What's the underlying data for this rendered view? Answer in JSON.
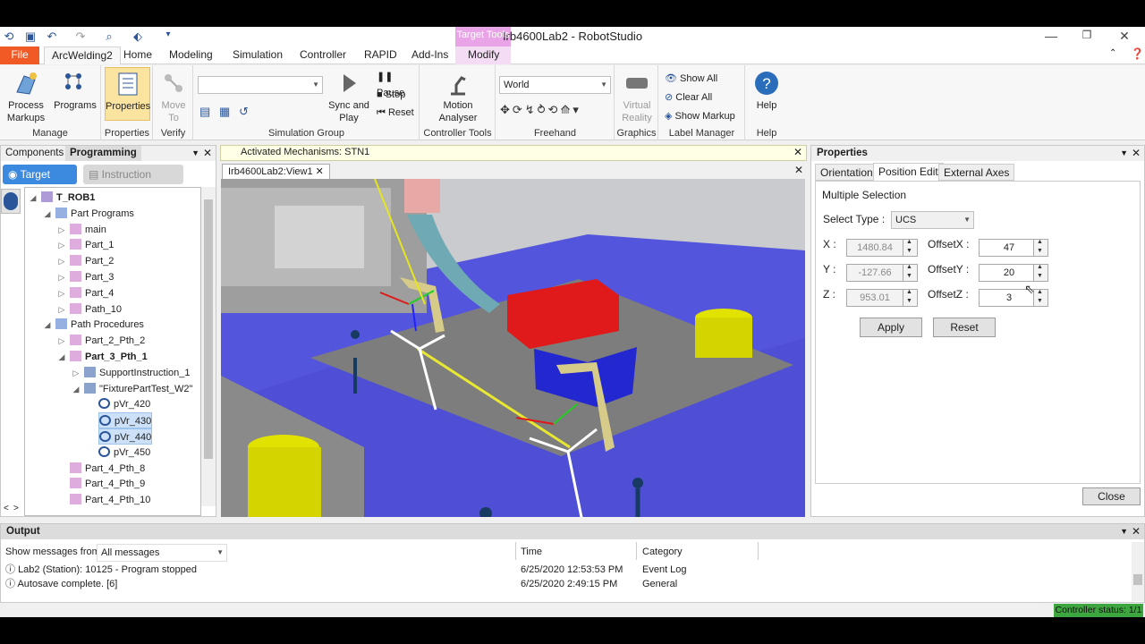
{
  "window": {
    "title": "Irb4600Lab2 - RobotStudio",
    "context_tab_group": "Target Tools"
  },
  "tabs": [
    "File",
    "ArcWelding2",
    "Home",
    "Modeling",
    "Simulation",
    "Controller",
    "RAPID",
    "Add-Ins",
    "Modify"
  ],
  "ribbon": {
    "manage": {
      "label": "Manage",
      "process_markups": "Process Markups",
      "programs": "Programs"
    },
    "properties": {
      "label": "Properties",
      "button": "Properties"
    },
    "verify": {
      "label": "Verify",
      "move_to": "Move To"
    },
    "simulation": {
      "label": "Simulation Group",
      "sync": "Sync and Play",
      "pause": "Pause",
      "stop": "Stop",
      "reset": "Reset"
    },
    "controller_tools": {
      "label": "Controller Tools",
      "motion": "Motion Analyser"
    },
    "freehand": {
      "label": "Freehand",
      "frame": "World"
    },
    "graphics": {
      "label": "Graphics",
      "vr": "Virtual Reality"
    },
    "label_manager": {
      "label": "Label Manager",
      "show_all": "Show All",
      "clear_all": "Clear All",
      "show_markup": "Show Markup"
    },
    "help": {
      "label": "Help",
      "button": "Help"
    }
  },
  "left_panel": {
    "tabs": [
      "Components",
      "Programming"
    ],
    "mode_target": "Target",
    "mode_instruction": "Instruction",
    "tree": [
      {
        "text": "T_ROB1",
        "bold": true,
        "level": 0,
        "exp": "◢"
      },
      {
        "text": "Part Programs",
        "level": 1,
        "exp": "◢"
      },
      {
        "text": "main",
        "level": 2,
        "exp": "▷"
      },
      {
        "text": "Part_1",
        "level": 2,
        "exp": "▷"
      },
      {
        "text": "Part_2",
        "level": 2,
        "exp": "▷"
      },
      {
        "text": "Part_3",
        "level": 2,
        "exp": "▷"
      },
      {
        "text": "Part_4",
        "level": 2,
        "exp": "▷"
      },
      {
        "text": "Path_10",
        "level": 2,
        "exp": "▷"
      },
      {
        "text": "Path Procedures",
        "level": 1,
        "exp": "◢"
      },
      {
        "text": "Part_2_Pth_2",
        "level": 2,
        "exp": "▷"
      },
      {
        "text": "Part_3_Pth_1",
        "bold": true,
        "level": 2,
        "exp": "◢"
      },
      {
        "text": "SupportInstruction_1",
        "level": 3,
        "exp": "▷"
      },
      {
        "text": "\"FixturePartTest_W2\"",
        "level": 3,
        "exp": "◢"
      },
      {
        "text": "pVr_420",
        "level": 4,
        "exp": ""
      },
      {
        "text": "pVr_430",
        "level": 4,
        "exp": "",
        "selected": true
      },
      {
        "text": "pVr_440",
        "level": 4,
        "exp": "",
        "selected": true
      },
      {
        "text": "pVr_450",
        "level": 4,
        "exp": ""
      },
      {
        "text": "Part_4_Pth_8",
        "level": 2,
        "exp": ""
      },
      {
        "text": "Part_4_Pth_9",
        "level": 2,
        "exp": ""
      },
      {
        "text": "Part_4_Pth_10",
        "level": 2,
        "exp": ""
      }
    ]
  },
  "center": {
    "activated": "Activated Mechanisms: STN1",
    "doc_tab": "Irb4600Lab2:View1"
  },
  "properties_panel": {
    "title": "Properties",
    "tabs": [
      "Orientation",
      "Position Edit",
      "External Axes"
    ],
    "section": "Multiple Selection",
    "select_type_label": "Select Type :",
    "select_type_value": "UCS",
    "x_label": "X :",
    "x_value": "1480.84",
    "y_label": "Y :",
    "y_value": "-127.66",
    "z_label": "Z :",
    "z_value": "953.01",
    "ox_label": "OffsetX :",
    "ox_value": "47",
    "oy_label": "OffsetY :",
    "oy_value": "20",
    "oz_label": "OffsetZ :",
    "oz_value": "3",
    "apply": "Apply",
    "reset": "Reset",
    "close": "Close"
  },
  "output": {
    "title": "Output",
    "filter_label": "Show messages from:",
    "filter_value": "All messages",
    "col_time": "Time",
    "col_category": "Category",
    "rows": [
      {
        "msg": "Lab2 (Station): 10125 - Program stopped",
        "time": "6/25/2020 12:53:53 PM",
        "cat": "Event Log"
      },
      {
        "msg": "Autosave complete. [6]",
        "time": "6/25/2020 2:49:15 PM",
        "cat": "General"
      }
    ]
  },
  "status": {
    "controller": "Controller status: 1/1"
  }
}
